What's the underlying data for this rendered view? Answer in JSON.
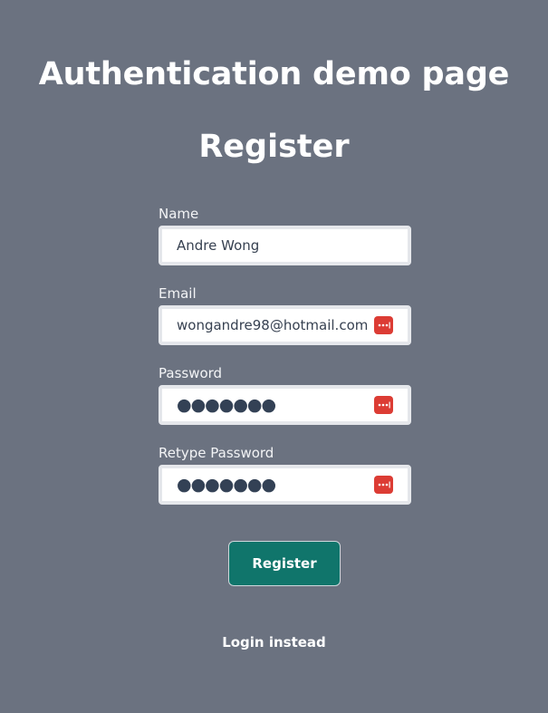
{
  "page": {
    "title": "Authentication demo page"
  },
  "form": {
    "title": "Register",
    "fields": {
      "name": {
        "label": "Name",
        "value": "Andre Wong"
      },
      "email": {
        "label": "Email",
        "value": "wongandre98@hotmail.com"
      },
      "password": {
        "label": "Password",
        "value": "●●●●●●●"
      },
      "retype_password": {
        "label": "Retype Password",
        "value": "●●●●●●●"
      }
    },
    "submit_label": "Register",
    "login_link": "Login instead"
  },
  "icons": {
    "password_manager": "password-manager-icon"
  },
  "colors": {
    "background": "#6b7280",
    "button": "#10756b",
    "password_manager_icon": "#dc3c34"
  }
}
